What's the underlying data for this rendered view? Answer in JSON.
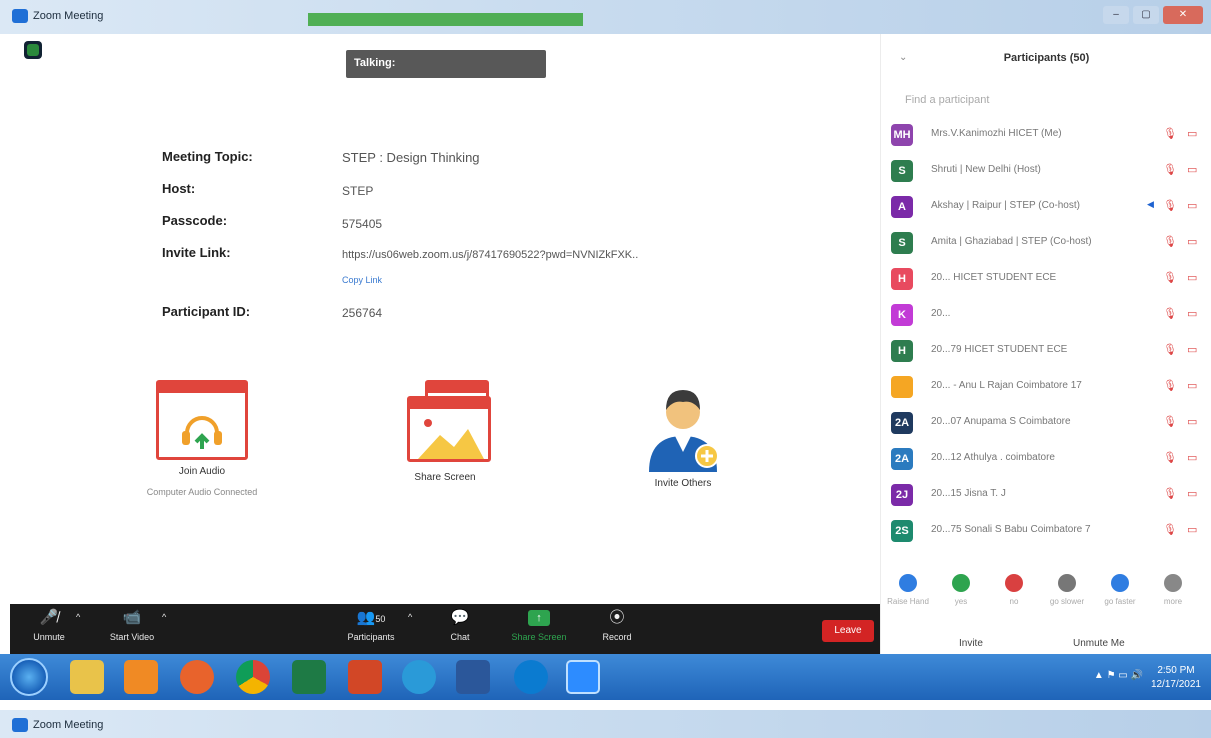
{
  "window": {
    "title": "Zoom Meeting"
  },
  "talking": {
    "label": "Talking:"
  },
  "meeting_info": [
    {
      "label": "Meeting Topic:",
      "value": "STEP : Design Thinking"
    },
    {
      "label": "Host:",
      "value": "STEP"
    },
    {
      "label": "Passcode:",
      "value": "575405"
    },
    {
      "label": "Invite Link:",
      "value": "https://us06web.zoom.us/j/87417690522?pwd=NVNIZkFXK.."
    },
    {
      "label": "Participant ID:",
      "value": "256764"
    }
  ],
  "copy_link": "Copy Link",
  "actions": {
    "join_audio": {
      "label": "Join Audio",
      "sub": "Computer Audio Connected"
    },
    "share_screen": {
      "label": "Share Screen"
    },
    "invite_others": {
      "label": "Invite Others"
    }
  },
  "toolbar": {
    "unmute": "Unmute",
    "start_video": "Start Video",
    "participants": "Participants",
    "participants_count": "50",
    "chat": "Chat",
    "share_screen": "Share Screen",
    "record": "Record",
    "leave": "Leave"
  },
  "panel": {
    "title": "Participants (50)",
    "search_placeholder": "Find a participant",
    "participants": [
      {
        "initials": "MH",
        "color": "#8e44ad",
        "name": "Mrs.V.Kanimozhi HICET (Me)"
      },
      {
        "initials": "S",
        "color": "#2e7d4f",
        "name": "Shruti | New Delhi (Host)"
      },
      {
        "initials": "A",
        "color": "#7b2aa8",
        "name": "Akshay | Raipur | STEP (Co-host)",
        "speaking": true
      },
      {
        "initials": "S",
        "color": "#2e7d4f",
        "name": "Amita | Ghaziabad | STEP (Co-host)"
      },
      {
        "initials": "H",
        "color": "#e84a5f",
        "name": "20... HICET STUDENT ECE"
      },
      {
        "initials": "K",
        "color": "#c23bd6",
        "name": "20..."
      },
      {
        "initials": "H",
        "color": "#2e7d4f",
        "name": "20...79 HICET STUDENT ECE"
      },
      {
        "initials": "",
        "color": "#f5a623",
        "name": "20... - Anu L Rajan Coimbatore 17"
      },
      {
        "initials": "2A",
        "color": "#1f3a5f",
        "name": "20...07 Anupama S Coimbatore"
      },
      {
        "initials": "2A",
        "color": "#2b7bbf",
        "name": "20...12 Athulya . coimbatore"
      },
      {
        "initials": "2J",
        "color": "#7b2aa8",
        "name": "20...15 Jisna T. J"
      },
      {
        "initials": "2S",
        "color": "#1d8a6e",
        "name": "20...75 Sonali S Babu Coimbatore 7"
      }
    ],
    "reactions": [
      {
        "label": "Raise Hand",
        "color": "#2f7de1"
      },
      {
        "label": "yes",
        "color": "#2ea44f"
      },
      {
        "label": "no",
        "color": "#d94040"
      },
      {
        "label": "go slower",
        "color": "#777777"
      },
      {
        "label": "go faster",
        "color": "#2f7de1"
      },
      {
        "label": "more",
        "color": "#888888"
      }
    ],
    "invite": "Invite",
    "unmute_me": "Unmute Me"
  },
  "taskbar": {
    "time": "2:50 PM",
    "date": "12/17/2021"
  }
}
